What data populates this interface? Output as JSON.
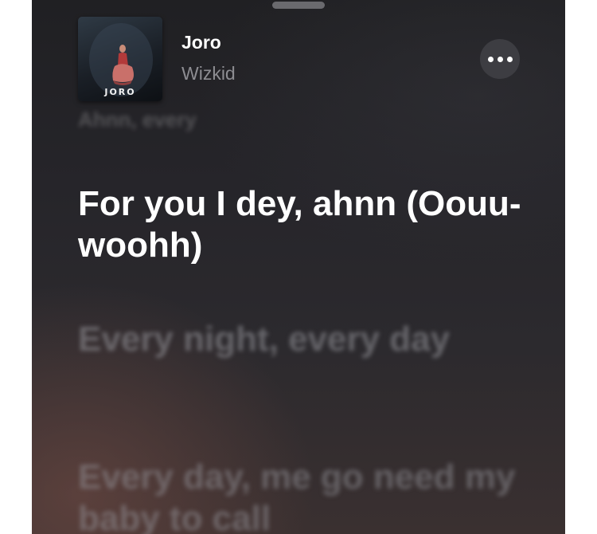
{
  "now_playing": {
    "title": "Joro",
    "artist": "Wizkid",
    "artwork_text": "JORO",
    "more_icon": "ellipsis-icon"
  },
  "lyrics": {
    "previous": "Ahnn, every",
    "current": "For you I dey, ahnn (Oouu-woohh)",
    "next": "Every night, every day",
    "after_next": "Every day, me go need my baby to call"
  }
}
